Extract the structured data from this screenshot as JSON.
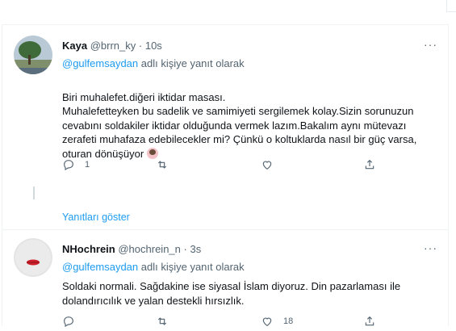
{
  "tweet1": {
    "name": "Kaya",
    "handle": "@brrn_ky",
    "time": "10s",
    "reply_to_mention": "@gulfemsaydan",
    "reply_to_suffix": "adlı kişiye yanıt olarak",
    "text": "Biri muhalefet.diğeri iktidar masası.\nMuhalefetteyken bu sadelik ve samimiyeti sergilemek kolay.Sizin sorunuzun cevabını soldakiler iktidar olduğunda vermek lazım.Bakalım aynı mütevazı zerafeti muhafaza edebilecekler mi? Çünkü o koltuklarda nasıl bir güç varsa, oturan dönüşüyor",
    "reply_count": "1",
    "retweet_count": "",
    "like_count": ""
  },
  "show_replies": "Yanıtları göster",
  "tweet2": {
    "name": "NHochrein",
    "handle": "@hochrein_n",
    "time": "3s",
    "reply_to_mention": "@gulfemsaydan",
    "reply_to_suffix": "adlı kişiye yanıt olarak",
    "text": "Soldaki normali. Sağdakine ise siyasal İslam diyoruz. Din pazarlaması ile dolandırıcılık ve yalan destekli hırsızlık.",
    "reply_count": "",
    "retweet_count": "",
    "like_count": "18"
  },
  "separator": "·",
  "more_glyph": "···",
  "icons": [
    "reply-icon",
    "retweet-icon",
    "like-icon",
    "share-icon",
    "more-icon"
  ]
}
